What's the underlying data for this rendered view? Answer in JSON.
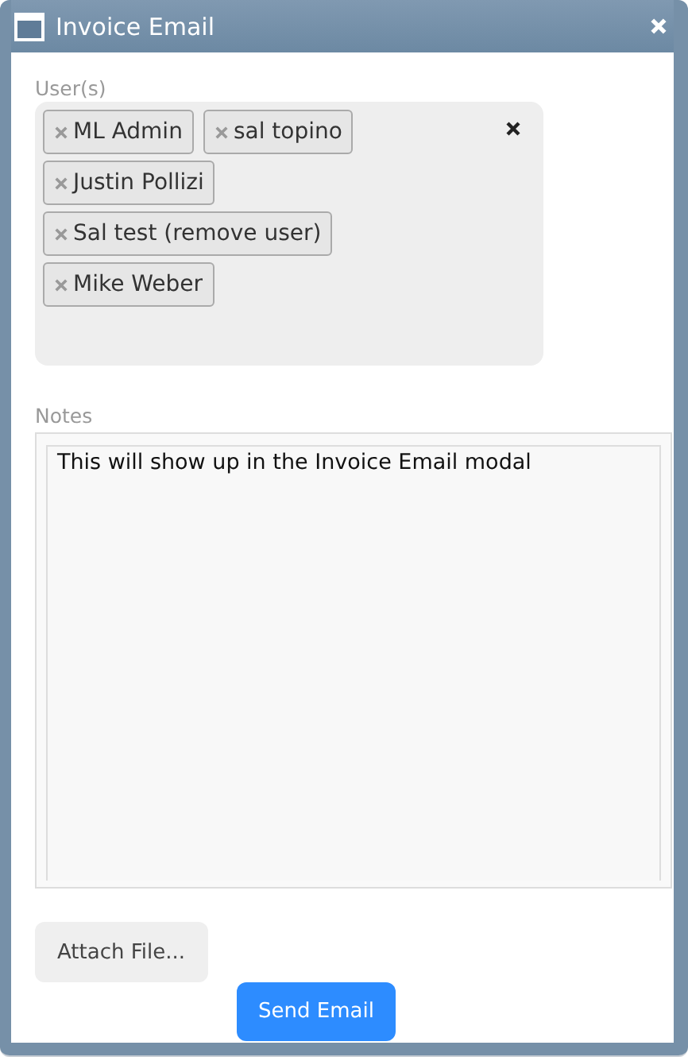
{
  "window": {
    "title": "Invoice Email"
  },
  "users": {
    "label": "User(s)",
    "tags": [
      {
        "name": "ML Admin"
      },
      {
        "name": "sal topino"
      },
      {
        "name": "Justin Pollizi"
      },
      {
        "name": "Sal test (remove user)"
      },
      {
        "name": "Mike Weber"
      }
    ]
  },
  "notes": {
    "label": "Notes",
    "value": "This will show up in the Invoice Email modal"
  },
  "buttons": [
    {
      "label": "Attach File...",
      "kind": "secondary"
    },
    {
      "label": "Send Email",
      "kind": "primary"
    }
  ]
}
